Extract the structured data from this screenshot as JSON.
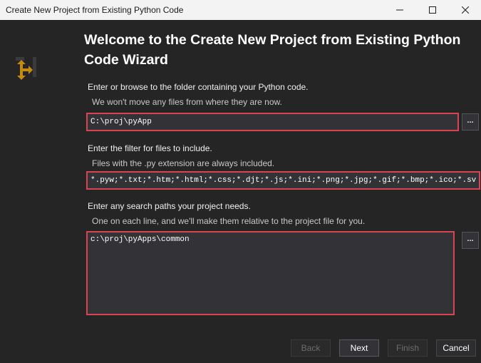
{
  "window": {
    "title": "Create New Project from Existing Python Code"
  },
  "logo": {
    "icon": "python-project-icon",
    "color": "#c58a12"
  },
  "heading": "Welcome to the Create New Project from Existing Python Code Wizard",
  "folder": {
    "label": "Enter or browse to the folder containing your Python code.",
    "hint": "We won't move any files from where they are now.",
    "value": "C:\\proj\\pyApp",
    "browse_label": "..."
  },
  "filter": {
    "label": "Enter the filter for files to include.",
    "hint": "Files with the .py extension are always included.",
    "value": "*.pyw;*.txt;*.htm;*.html;*.css;*.djt;*.js;*.ini;*.png;*.jpg;*.gif;*.bmp;*.ico;*.sv"
  },
  "search_paths": {
    "label": "Enter any search paths your project needs.",
    "hint": "One on each line, and we'll make them relative to the project file for you.",
    "value": "c:\\proj\\pyApps\\common",
    "browse_label": "..."
  },
  "buttons": {
    "back": "Back",
    "next": "Next",
    "finish": "Finish",
    "cancel": "Cancel"
  },
  "colors": {
    "highlight_border": "#d94451",
    "background": "#252526"
  }
}
